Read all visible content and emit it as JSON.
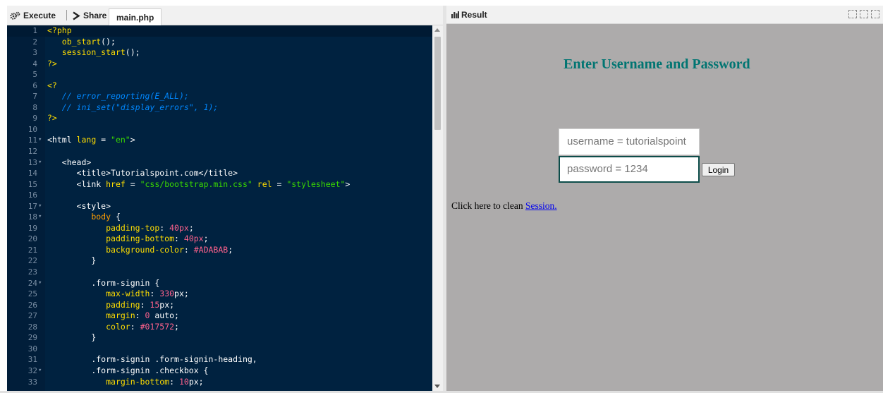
{
  "toolbar": {
    "execute_label": "Execute",
    "share_label": "Share",
    "tab_label": "main.php"
  },
  "editor": {
    "lines": [
      {
        "n": "1",
        "fold": "",
        "html": "<span class='tag'>&lt;?php</span>"
      },
      {
        "n": "2",
        "fold": "",
        "html": "   <span class='fn'>ob_start</span><span class='white'>();</span>"
      },
      {
        "n": "3",
        "fold": "",
        "html": "   <span class='fn'>session_start</span><span class='white'>();</span>"
      },
      {
        "n": "4",
        "fold": "",
        "html": "<span class='tag'>?&gt;</span>"
      },
      {
        "n": "5",
        "fold": "",
        "html": ""
      },
      {
        "n": "6",
        "fold": "",
        "html": "<span class='tag'>&lt;?</span>"
      },
      {
        "n": "7",
        "fold": "",
        "html": "   <span class='cm'>// error_reporting(E_ALL);</span>"
      },
      {
        "n": "8",
        "fold": "",
        "html": "   <span class='cm'>// ini_set(\"display_errors\", 1);</span>"
      },
      {
        "n": "9",
        "fold": "",
        "html": "<span class='tag'>?&gt;</span>"
      },
      {
        "n": "10",
        "fold": "",
        "html": ""
      },
      {
        "n": "11",
        "fold": "▾",
        "html": "<span class='white'>&lt;html </span><span class='kw'>lang</span><span class='white'> = </span><span class='str'>\"en\"</span><span class='white'>&gt;</span>"
      },
      {
        "n": "12",
        "fold": "",
        "html": ""
      },
      {
        "n": "13",
        "fold": "▾",
        "html": "   <span class='white'>&lt;head&gt;</span>"
      },
      {
        "n": "14",
        "fold": "",
        "html": "      <span class='white'>&lt;title&gt;Tutorialspoint.com&lt;/title&gt;</span>"
      },
      {
        "n": "15",
        "fold": "",
        "html": "      <span class='white'>&lt;link </span><span class='kw'>href</span><span class='white'> = </span><span class='str'>\"css/bootstrap.min.css\"</span><span class='white'> </span><span class='kw'>rel</span><span class='white'> = </span><span class='str'>\"stylesheet\"</span><span class='white'>&gt;</span>"
      },
      {
        "n": "16",
        "fold": "",
        "html": ""
      },
      {
        "n": "17",
        "fold": "▾",
        "html": "      <span class='white'>&lt;style&gt;</span>"
      },
      {
        "n": "18",
        "fold": "▾",
        "html": "         <span class='sel'>body</span><span class='white'> {</span>"
      },
      {
        "n": "19",
        "fold": "",
        "html": "            <span class='prop'>padding-top</span><span class='white'>: </span><span class='num'>40px</span><span class='white'>;</span>"
      },
      {
        "n": "20",
        "fold": "",
        "html": "            <span class='prop'>padding-bottom</span><span class='white'>: </span><span class='num'>40px</span><span class='white'>;</span>"
      },
      {
        "n": "21",
        "fold": "",
        "html": "            <span class='prop'>background-color</span><span class='white'>: </span><span class='col'>#ADABAB</span><span class='white'>;</span>"
      },
      {
        "n": "22",
        "fold": "",
        "html": "         <span class='white'>}</span>"
      },
      {
        "n": "23",
        "fold": "",
        "html": ""
      },
      {
        "n": "24",
        "fold": "▾",
        "html": "         <span class='white'>.form-signin {</span>"
      },
      {
        "n": "25",
        "fold": "",
        "html": "            <span class='prop'>max-width</span><span class='white'>: </span><span class='num'>330</span><span class='white'>px;</span>"
      },
      {
        "n": "26",
        "fold": "",
        "html": "            <span class='prop'>padding</span><span class='white'>: </span><span class='num'>15</span><span class='white'>px;</span>"
      },
      {
        "n": "27",
        "fold": "",
        "html": "            <span class='prop'>margin</span><span class='white'>: </span><span class='num'>0</span><span class='white'> auto;</span>"
      },
      {
        "n": "28",
        "fold": "",
        "html": "            <span class='prop'>color</span><span class='white'>: </span><span class='col'>#017572</span><span class='white'>;</span>"
      },
      {
        "n": "29",
        "fold": "",
        "html": "         <span class='white'>}</span>"
      },
      {
        "n": "30",
        "fold": "",
        "html": ""
      },
      {
        "n": "31",
        "fold": "",
        "html": "         <span class='white'>.form-signin .form-signin-heading,</span>"
      },
      {
        "n": "32",
        "fold": "▾",
        "html": "         <span class='white'>.form-signin .checkbox {</span>"
      },
      {
        "n": "33",
        "fold": "",
        "html": "            <span class='prop'>margin-bottom</span><span class='white'>: </span><span class='num'>10</span><span class='white'>px;</span>"
      }
    ]
  },
  "result_panel": {
    "title": "Result",
    "heading": "Enter Username and Password",
    "username_value": "username = tutorialspoint",
    "password_value": "password = 1234",
    "login_label": "Login",
    "clean_text": "Click here to clean ",
    "clean_link": "Session."
  }
}
